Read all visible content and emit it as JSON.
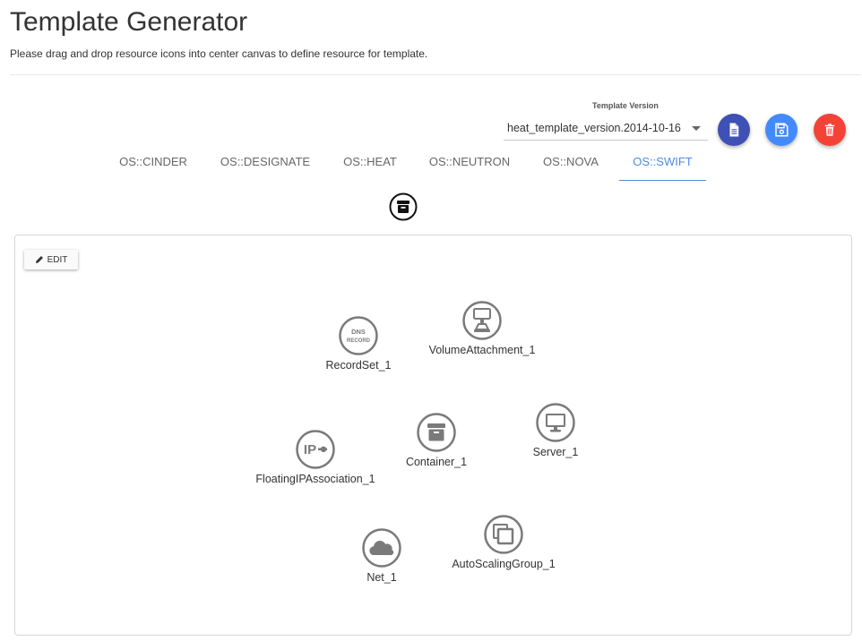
{
  "header": {
    "title": "Template Generator",
    "subtitle": "Please drag and drop resource icons into center canvas to define resource for template."
  },
  "version": {
    "label": "Template Version",
    "selected": "heat_template_version.2014-10-16"
  },
  "actions": [
    {
      "name": "view-template",
      "icon": "file-text-icon",
      "color": "#3f51b5"
    },
    {
      "name": "save-template",
      "icon": "floppy-icon",
      "color": "#448aff"
    },
    {
      "name": "delete-template",
      "icon": "trash-icon",
      "color": "#f44336"
    }
  ],
  "tabs": [
    {
      "label": "OS::CINDER",
      "active": false
    },
    {
      "label": "OS::DESIGNATE",
      "active": false
    },
    {
      "label": "OS::HEAT",
      "active": false
    },
    {
      "label": "OS::NEUTRON",
      "active": false
    },
    {
      "label": "OS::NOVA",
      "active": false
    },
    {
      "label": "OS::SWIFT",
      "active": true
    }
  ],
  "palette": {
    "icon": "container-icon"
  },
  "canvas": {
    "edit_label": "EDIT",
    "nodes": [
      {
        "label": "RecordSet_1",
        "icon": "dns-record-icon"
      },
      {
        "label": "VolumeAttachment_1",
        "icon": "volume-attachment-icon"
      },
      {
        "label": "FloatingIPAssociation_1",
        "icon": "floating-ip-icon"
      },
      {
        "label": "Container_1",
        "icon": "container-icon"
      },
      {
        "label": "Server_1",
        "icon": "server-icon"
      },
      {
        "label": "Net_1",
        "icon": "cloud-icon"
      },
      {
        "label": "AutoScalingGroup_1",
        "icon": "autoscaling-icon"
      }
    ]
  },
  "colors": {
    "accent": "#4c8be0",
    "node_gray": "#7a7a7a"
  }
}
